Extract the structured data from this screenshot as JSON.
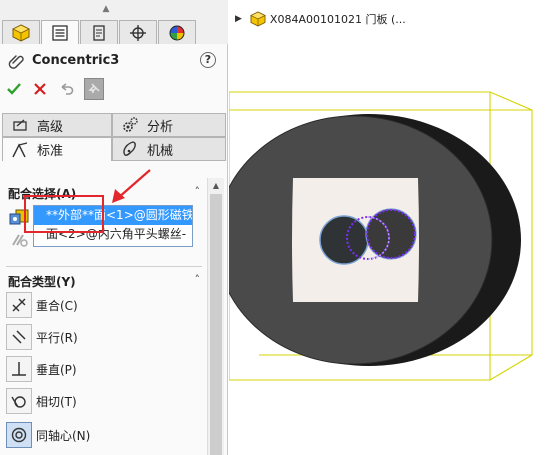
{
  "feature": {
    "title": "Concentric3",
    "help": "?"
  },
  "tabs": {
    "secondary": [
      {
        "label": "高级"
      },
      {
        "label": "分析"
      },
      {
        "label": "标准"
      },
      {
        "label": "机械"
      }
    ]
  },
  "mate_selections": {
    "title": "配合选择(A)",
    "items": [
      "**外部**面<1>@圆形磁铁",
      "面<2>@内六角平头螺丝-"
    ]
  },
  "mate_types": {
    "title": "配合类型(Y)",
    "items": [
      {
        "label": "重合(C)",
        "icon": "coincident-icon"
      },
      {
        "label": "平行(R)",
        "icon": "parallel-icon"
      },
      {
        "label": "垂直(P)",
        "icon": "perpendicular-icon"
      },
      {
        "label": "相切(T)",
        "icon": "tangent-icon"
      },
      {
        "label": "同轴心(N)",
        "icon": "concentric-icon",
        "active": true
      }
    ]
  },
  "tree": {
    "label": "X084A00101021 门板 (..."
  },
  "colors": {
    "selection_blue": "#3399ff",
    "annotation_red": "#e3262b",
    "bbox_yellow": "#d4d400",
    "highlight_purple": "#7b2ff7"
  }
}
